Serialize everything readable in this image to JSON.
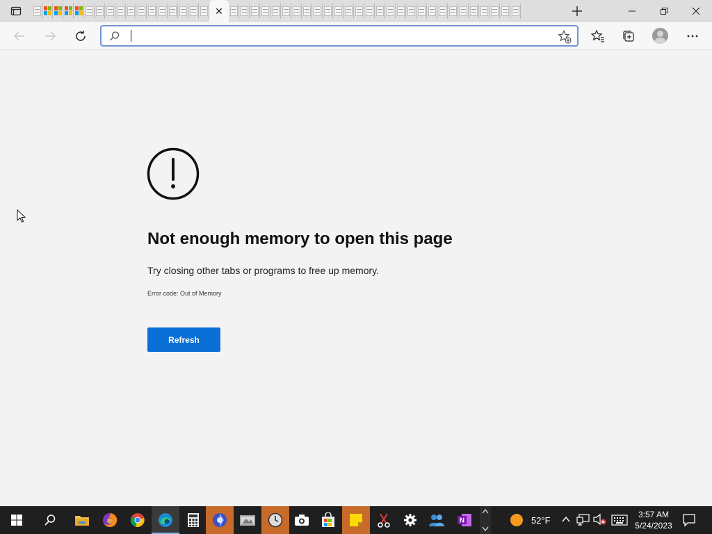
{
  "browser": {
    "address_value": "",
    "address_placeholder": "",
    "background_tab_count": 45
  },
  "error_page": {
    "title": "Not enough memory to open this page",
    "description": "Try closing other tabs or programs to free up memory.",
    "error_code": "Error code: Out of Memory",
    "refresh_label": "Refresh"
  },
  "taskbar": {
    "weather_temp": "52°F",
    "time": "3:57 AM",
    "date": "5/24/2023"
  },
  "colors": {
    "accent": "#0a6fd6",
    "page_bg": "#f3f3f3",
    "taskbar_bg": "#1f1f1f"
  }
}
